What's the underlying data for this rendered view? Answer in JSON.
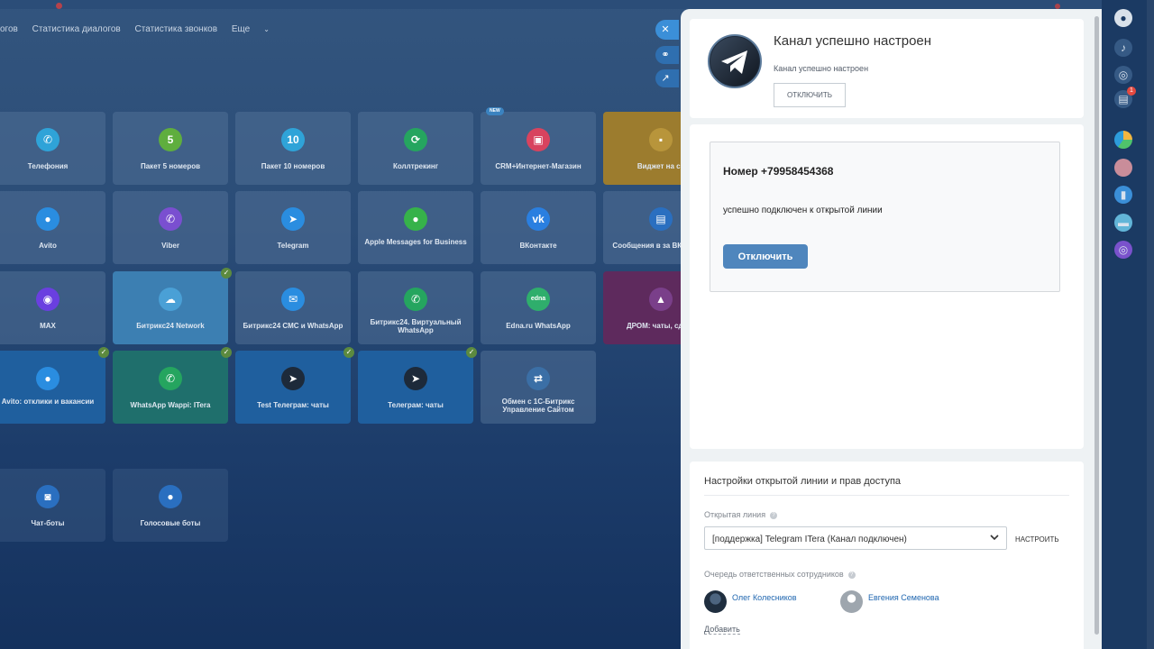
{
  "nav": {
    "items": [
      "огов",
      "Статистика диалогов",
      "Статистика звонков",
      "Еще"
    ]
  },
  "tiles": [
    {
      "label": "Телефония",
      "icon": "phone-icon",
      "glyph": "✆",
      "color": "#2fa3d8"
    },
    {
      "label": "Пакет 5 номеров",
      "icon": "package-5-icon",
      "glyph": "5",
      "color": "#5fae3e"
    },
    {
      "label": "Пакет 10 номеров",
      "icon": "package-10-icon",
      "glyph": "10",
      "color": "#2fa3d8"
    },
    {
      "label": "Коллтрекинг",
      "icon": "calltracking-icon",
      "glyph": "⟳",
      "color": "#25a55f"
    },
    {
      "label": "CRM+Интернет-Магазин",
      "icon": "shop-icon",
      "glyph": "▣",
      "color": "#d8435e",
      "badge": "NEW"
    },
    {
      "label": "Виджет на са",
      "icon": "chat-widget-icon",
      "glyph": "▪",
      "color": "#b8953b"
    },
    {
      "label": "Avito",
      "icon": "avito-icon",
      "glyph": "●",
      "color": "#2a8de0"
    },
    {
      "label": "Viber",
      "icon": "viber-icon",
      "glyph": "✆",
      "color": "#7a4fd0"
    },
    {
      "label": "Telegram",
      "icon": "telegram-icon",
      "glyph": "➤",
      "color": "#2a8de0"
    },
    {
      "label": "Apple Messages for Business",
      "icon": "apple-messages-icon",
      "glyph": "●",
      "color": "#36b24a"
    },
    {
      "label": "ВКонтакте",
      "icon": "vk-icon",
      "glyph": "vk",
      "color": "#2a7fe0"
    },
    {
      "label": "Сообщения в за ВКонтакте",
      "icon": "vk-shop-icon",
      "glyph": "▤",
      "color": "#2a6fc0"
    },
    {
      "label": "MAX",
      "icon": "max-icon",
      "glyph": "◉",
      "color": "#6a3fe0"
    },
    {
      "label": "Битрикс24 Network",
      "icon": "cloud-icon",
      "glyph": "☁",
      "color": "#4aa0d6",
      "checked": true
    },
    {
      "label": "Битрикс24 СМС и WhatsApp",
      "icon": "sms-icon",
      "glyph": "✉",
      "color": "#2a8de0"
    },
    {
      "label": "Битрикс24. Виртуальный WhatsApp",
      "icon": "whatsapp-icon",
      "glyph": "✆",
      "color": "#25a55f"
    },
    {
      "label": "Edna.ru WhatsApp",
      "icon": "edna-icon",
      "glyph": "edna",
      "color": "#2fae6c"
    },
    {
      "label": "ДРОМ: чаты, сделк",
      "icon": "drom-icon",
      "glyph": "▲",
      "color": "#7a3f8a"
    },
    {
      "label": "Avito: отклики и вакансии",
      "icon": "avito-jobs-icon",
      "glyph": "●",
      "color": "#2a8de0",
      "checked": true
    },
    {
      "label": "WhatsApp Wappi: ITera",
      "icon": "whatsapp-icon",
      "glyph": "✆",
      "color": "#25a55f",
      "checked": true
    },
    {
      "label": "Test Телеграм: чаты",
      "icon": "telegram-icon",
      "glyph": "➤",
      "color": "#1d2a3a",
      "checked": true
    },
    {
      "label": "Телеграм: чаты",
      "icon": "telegram-icon",
      "glyph": "➤",
      "color": "#1d2a3a",
      "checked": true
    },
    {
      "label": "Обмен с 1С-Битрикс Управление Сайтом",
      "icon": "exchange-icon",
      "glyph": "⇄",
      "color": "#3b6fa6"
    },
    {
      "label": "Чат-боты",
      "icon": "bot-icon",
      "glyph": "◙",
      "color": "#2a6fc0"
    },
    {
      "label": "Голосовые боты",
      "icon": "mic-icon",
      "glyph": "●",
      "color": "#2a6fc0"
    }
  ],
  "slider": {
    "header": {
      "title": "Канал успешно настроен",
      "subtitle": "Канал успешно настроен",
      "button": "отключить"
    },
    "info": {
      "number": "Номер +79958454368",
      "status": "успешно подключен к открытой линии",
      "button": "Отключить"
    },
    "settings": {
      "title": "Настройки открытой линии и прав доступа",
      "open_line_label": "Открытая линия",
      "open_line_value": "[поддержка] Telegram ITera (Канал подключен)",
      "configure": "настроить",
      "queue_label": "Очередь ответственных сотрудников",
      "users": [
        "Олег Колесников",
        "Евгения Семенова"
      ],
      "add": "Добавить"
    }
  },
  "rail": {
    "badge_count": "1"
  },
  "colors": {
    "accent": "#4f86bd",
    "link": "#2067b0",
    "check": "#5c8a3f"
  }
}
